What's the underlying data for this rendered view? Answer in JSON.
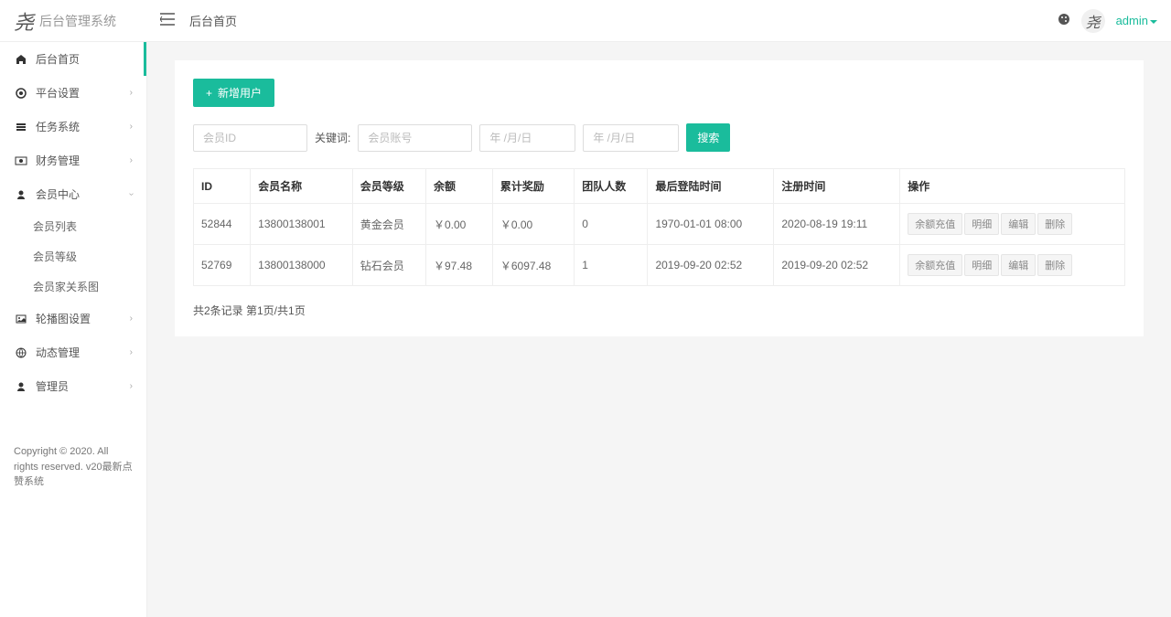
{
  "header": {
    "logo_text": "后台管理系统",
    "breadcrumb": "后台首页",
    "user_name": "admin"
  },
  "sidebar": {
    "items": [
      {
        "label": "后台首页",
        "icon": "home",
        "expandable": false,
        "active": true
      },
      {
        "label": "平台设置",
        "icon": "gear",
        "expandable": true
      },
      {
        "label": "任务系统",
        "icon": "list",
        "expandable": true
      },
      {
        "label": "财务管理",
        "icon": "money",
        "expandable": true
      },
      {
        "label": "会员中心",
        "icon": "user",
        "expandable": true,
        "expanded": true
      },
      {
        "label": "轮播图设置",
        "icon": "image",
        "expandable": true
      },
      {
        "label": "动态管理",
        "icon": "globe",
        "expandable": true
      },
      {
        "label": "管理员",
        "icon": "user",
        "expandable": true
      }
    ],
    "sub_items_member": [
      {
        "label": "会员列表"
      },
      {
        "label": "会员等级"
      },
      {
        "label": "会员家关系图"
      }
    ],
    "footer": "Copyright © 2020. All rights reserved. v20最新点赞系统"
  },
  "toolbar": {
    "add_user_label": "新增用户",
    "member_id_placeholder": "会员ID",
    "keyword_label": "关键词:",
    "member_account_placeholder": "会员账号",
    "date_placeholder": "年 /月/日",
    "search_label": "搜索"
  },
  "table": {
    "headers": [
      "ID",
      "会员名称",
      "会员等级",
      "余额",
      "累计奖励",
      "团队人数",
      "最后登陆时间",
      "注册时间",
      "操作"
    ],
    "rows": [
      {
        "id": "52844",
        "name": "13800138001",
        "level": "黄金会员",
        "balance": "￥0.00",
        "reward": "￥0.00",
        "team": "0",
        "last_login": "1970-01-01 08:00",
        "register": "2020-08-19 19:11"
      },
      {
        "id": "52769",
        "name": "13800138000",
        "level": "钻石会员",
        "balance": "￥97.48",
        "reward": "￥6097.48",
        "team": "1",
        "last_login": "2019-09-20 02:52",
        "register": "2019-09-20 02:52"
      }
    ],
    "actions": [
      "余额充值",
      "明细",
      "编辑",
      "删除"
    ]
  },
  "pagination": {
    "info": "共2条记录 第1页/共1页"
  }
}
